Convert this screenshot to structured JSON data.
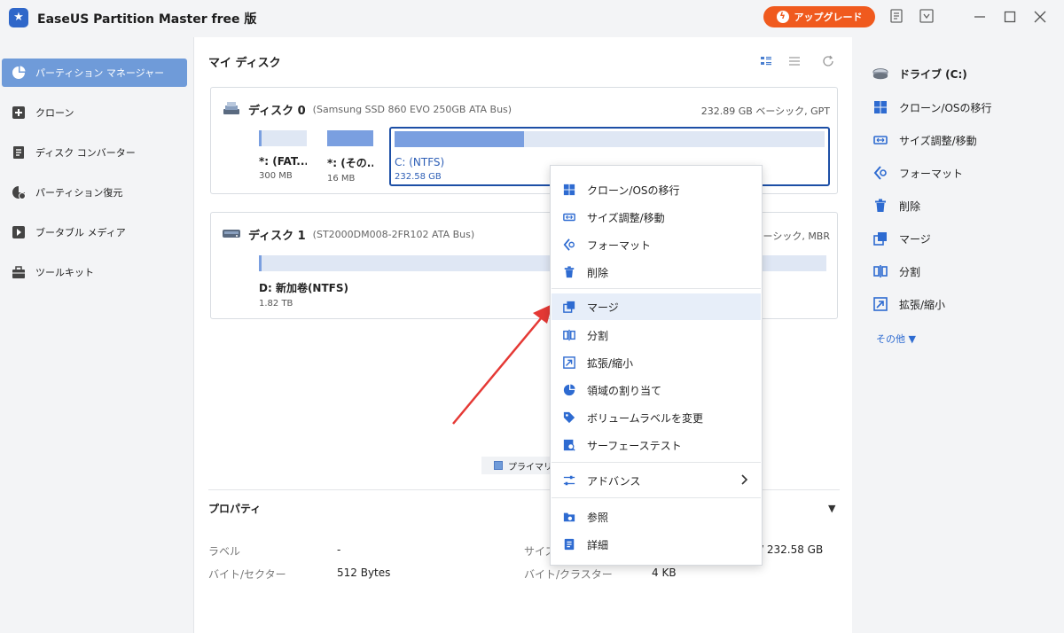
{
  "window": {
    "title": "EaseUS Partition Master free 版",
    "upgrade_label": "アップグレード"
  },
  "sidebar": {
    "items": [
      {
        "label": "パーティション マネージャー",
        "icon": "pie-chart-icon",
        "active": true
      },
      {
        "label": "クローン",
        "icon": "clone-plus-icon"
      },
      {
        "label": "ディスク コンバーター",
        "icon": "disk-converter-icon"
      },
      {
        "label": "パーティション復元",
        "icon": "partition-recovery-icon"
      },
      {
        "label": "ブータブル メディア",
        "icon": "bootable-media-icon"
      },
      {
        "label": "ツールキット",
        "icon": "toolbox-icon"
      }
    ]
  },
  "main": {
    "title": "マイ ディスク",
    "disks": [
      {
        "name": "ディスク 0",
        "model": "(Samsung SSD 860 EVO 250GB ATA Bus)",
        "info": "232.89 GB ベーシック, GPT",
        "partitions": [
          {
            "name": "*: (FAT...",
            "size": "300 MB",
            "used": 0.05
          },
          {
            "name": "*: (その...",
            "size": "16 MB",
            "used": 1.0
          },
          {
            "name": "C: (NTFS)",
            "size": "232.58 GB",
            "used": 0.3,
            "selected": true
          }
        ]
      },
      {
        "name": "ディスク 1",
        "model": "(ST2000DM008-2FR102 ATA Bus)",
        "info": "ベーシック, MBR",
        "partitions": [
          {
            "name": "D: 新加卷(NTFS)",
            "size": "1.82 TB",
            "used": 0.005
          }
        ]
      }
    ],
    "legend_label": "プライマリ",
    "properties": {
      "title": "プロパティ",
      "rows": [
        {
          "label": "ラベル",
          "value": "-"
        },
        {
          "label": "バイト/セクター",
          "value": "512 Bytes"
        },
        {
          "label": "サイズ",
          "value": "/ 232.58 GB"
        },
        {
          "label": "バイト/クラスター",
          "value": "4 KB"
        }
      ]
    }
  },
  "right_panel": {
    "items": [
      {
        "label": "ドライブ (C:)",
        "icon": "drive-icon",
        "bold": true
      },
      {
        "label": "クローン/OSの移行",
        "icon": "windows-icon"
      },
      {
        "label": "サイズ調整/移動",
        "icon": "resize-icon"
      },
      {
        "label": "フォーマット",
        "icon": "format-icon"
      },
      {
        "label": "削除",
        "icon": "trash-icon"
      },
      {
        "label": "マージ",
        "icon": "merge-icon"
      },
      {
        "label": "分割",
        "icon": "split-icon"
      },
      {
        "label": "拡張/縮小",
        "icon": "extend-shrink-icon"
      }
    ],
    "more_label": "その他 ▼"
  },
  "context_menu": {
    "items": [
      {
        "label": "クローン/OSの移行",
        "icon": "windows-icon"
      },
      {
        "label": "サイズ調整/移動",
        "icon": "resize-icon"
      },
      {
        "label": "フォーマット",
        "icon": "format-icon"
      },
      {
        "label": "削除",
        "icon": "trash-icon"
      },
      {
        "label": "マージ",
        "icon": "merge-icon",
        "highlighted": true
      },
      {
        "label": "分割",
        "icon": "split-icon"
      },
      {
        "label": "拡張/縮小",
        "icon": "extend-shrink-icon"
      },
      {
        "label": "領域の割り当て",
        "icon": "allocate-space-icon"
      },
      {
        "label": "ボリュームラベルを変更",
        "icon": "tag-icon"
      },
      {
        "label": "サーフェーステスト",
        "icon": "surface-test-icon"
      },
      {
        "label": "アドバンス",
        "icon": "sliders-icon",
        "submenu": true
      },
      {
        "label": "参照",
        "icon": "explore-icon"
      },
      {
        "label": "詳細",
        "icon": "details-icon"
      }
    ]
  },
  "colors": {
    "accent": "#6f9bd9",
    "selected_border": "#1d4fa6",
    "upgrade": "#f05a1e",
    "icon_blue": "#2e6bd1",
    "arrow_red": "#e53935"
  }
}
